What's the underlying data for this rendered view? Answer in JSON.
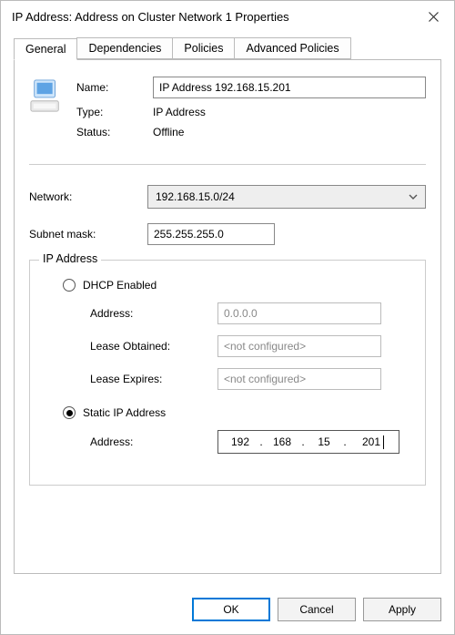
{
  "window": {
    "title": "IP Address: Address on Cluster Network 1 Properties"
  },
  "tabs": {
    "general": "General",
    "dependencies": "Dependencies",
    "policies": "Policies",
    "advanced": "Advanced Policies"
  },
  "general": {
    "name_label": "Name:",
    "name_value": "IP Address 192.168.15.201",
    "type_label": "Type:",
    "type_value": "IP Address",
    "status_label": "Status:",
    "status_value": "Offline"
  },
  "network": {
    "label": "Network:",
    "value": "192.168.15.0/24",
    "subnet_label": "Subnet mask:",
    "subnet_value": "255.255.255.0"
  },
  "ip_group": {
    "legend": "IP Address",
    "dhcp_label": "DHCP Enabled",
    "dhcp_address_label": "Address:",
    "dhcp_address_value": "0.0.0.0",
    "lease_obtained_label": "Lease Obtained:",
    "lease_obtained_value": "<not configured>",
    "lease_expires_label": "Lease Expires:",
    "lease_expires_value": "<not configured>",
    "static_label": "Static IP Address",
    "static_address_label": "Address:",
    "static_oct1": "192",
    "static_oct2": "168",
    "static_oct3": "15",
    "static_oct4": "201"
  },
  "buttons": {
    "ok": "OK",
    "cancel": "Cancel",
    "apply": "Apply"
  }
}
